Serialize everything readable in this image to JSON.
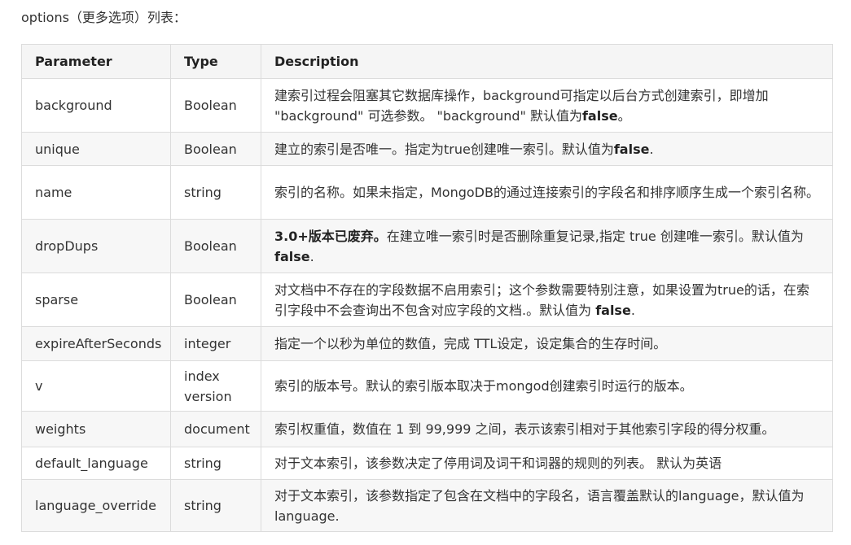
{
  "intro": "options（更多选项）列表：",
  "headers": [
    "Parameter",
    "Type",
    "Description"
  ],
  "rows": [
    {
      "param": "background",
      "type": "Boolean",
      "desc_pre": "建索引过程会阻塞其它数据库操作，background可指定以后台方式创建索引，即增加 \"background\" 可选参数。 \"background\" 默认值为",
      "desc_bold": "false",
      "desc_post": "。"
    },
    {
      "param": "unique",
      "type": "Boolean",
      "desc_pre": "建立的索引是否唯一。指定为true创建唯一索引。默认值为",
      "desc_bold": "false",
      "desc_post": "."
    },
    {
      "param": "name",
      "type": "string",
      "desc_pre": "索引的名称。如果未指定，MongoDB的通过连接索引的字段名和排序顺序生成一个索引名称。",
      "desc_bold": "",
      "desc_post": ""
    },
    {
      "param": "dropDups",
      "type": "Boolean",
      "desc_lead_bold": "3.0+版本已废弃。",
      "desc_pre": "在建立唯一索引时是否删除重复记录,指定 true 创建唯一索引。默认值为 ",
      "desc_bold": "false",
      "desc_post": "."
    },
    {
      "param": "sparse",
      "type": "Boolean",
      "desc_pre": "对文档中不存在的字段数据不启用索引；这个参数需要特别注意，如果设置为true的话，在索引字段中不会查询出不包含对应字段的文档.。默认值为 ",
      "desc_bold": "false",
      "desc_post": "."
    },
    {
      "param": "expireAfterSeconds",
      "type": "integer",
      "desc_pre": "指定一个以秒为单位的数值，完成 TTL设定，设定集合的生存时间。",
      "desc_bold": "",
      "desc_post": ""
    },
    {
      "param": "v",
      "type": "index version",
      "desc_pre": "索引的版本号。默认的索引版本取决于mongod创建索引时运行的版本。",
      "desc_bold": "",
      "desc_post": ""
    },
    {
      "param": "weights",
      "type": "document",
      "desc_pre": "索引权重值，数值在 1 到 99,999 之间，表示该索引相对于其他索引字段的得分权重。",
      "desc_bold": "",
      "desc_post": ""
    },
    {
      "param": "default_language",
      "type": "string",
      "desc_pre": "对于文本索引，该参数决定了停用词及词干和词器的规则的列表。 默认为英语",
      "desc_bold": "",
      "desc_post": ""
    },
    {
      "param": "language_override",
      "type": "string",
      "desc_pre": "对于文本索引，该参数指定了包含在文档中的字段名，语言覆盖默认的language，默认值为 language.",
      "desc_bold": "",
      "desc_post": ""
    }
  ]
}
